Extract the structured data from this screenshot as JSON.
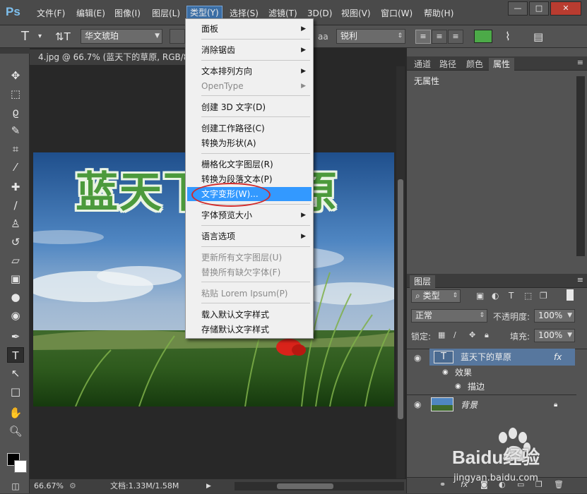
{
  "app": {
    "logo": "Ps"
  },
  "menubar": {
    "items": [
      "文件(F)",
      "编辑(E)",
      "图像(I)",
      "图层(L)",
      "类型(Y)",
      "选择(S)",
      "滤镜(T)",
      "3D(D)",
      "视图(V)",
      "窗口(W)",
      "帮助(H)"
    ],
    "active": "类型(Y)"
  },
  "window_controls": {
    "minimize": "—",
    "maximize": "□",
    "close": "✕"
  },
  "options": {
    "font_family": "华文琥珀",
    "antialias_label": "aa",
    "antialias": "锐利"
  },
  "document": {
    "tab_title": "4.jpg @ 66.7% (蓝天下的草原, RGB/8#",
    "canvas_text": "蓝天下的草原",
    "zoom": "66.67%",
    "file_size": "文档:1.33M/1.58M"
  },
  "panels_top": {
    "tabs": [
      "通道",
      "路径",
      "颜色",
      "属性"
    ],
    "active_tab": "属性",
    "content": "无属性"
  },
  "layers_panel": {
    "title": "图层",
    "filter_kind": "类型",
    "blend_mode": "正常",
    "opacity_label": "不透明度:",
    "opacity": "100%",
    "lock_label": "锁定:",
    "fill_label": "填充:",
    "fill": "100%",
    "layers": [
      {
        "name": "蓝天下的草原",
        "kind": "text",
        "fx": "fx",
        "effects_label": "效果",
        "effects": [
          "描边"
        ]
      },
      {
        "name": "背景",
        "kind": "image"
      }
    ]
  },
  "type_menu": {
    "items": [
      {
        "label": "面板",
        "submenu": true,
        "enabled": true
      },
      {
        "label": "消除锯齿",
        "submenu": true,
        "enabled": true
      },
      {
        "label": "文本排列方向",
        "submenu": true,
        "enabled": true
      },
      {
        "label": "OpenType",
        "submenu": true,
        "enabled": false
      },
      {
        "label": "创建 3D 文字(D)",
        "submenu": false,
        "enabled": true
      },
      {
        "label": "创建工作路径(C)",
        "submenu": false,
        "enabled": true
      },
      {
        "label": "转换为形状(A)",
        "submenu": false,
        "enabled": true
      },
      {
        "label": "栅格化文字图层(R)",
        "submenu": false,
        "enabled": true
      },
      {
        "label": "转换为段落文本(P)",
        "submenu": false,
        "enabled": true
      },
      {
        "label": "文字变形(W)...",
        "submenu": false,
        "enabled": true,
        "highlighted": true
      },
      {
        "label": "字体预览大小",
        "submenu": true,
        "enabled": true
      },
      {
        "label": "语言选项",
        "submenu": true,
        "enabled": true
      },
      {
        "label": "更新所有文字图层(U)",
        "submenu": false,
        "enabled": false
      },
      {
        "label": "替换所有缺欠字体(F)",
        "submenu": false,
        "enabled": false
      },
      {
        "label": "粘贴 Lorem Ipsum(P)",
        "submenu": false,
        "enabled": false
      },
      {
        "label": "载入默认文字样式",
        "submenu": false,
        "enabled": true
      },
      {
        "label": "存储默认文字样式",
        "submenu": false,
        "enabled": true
      }
    ]
  },
  "watermark": {
    "brand": "Baidu经验",
    "url": "jingyan.baidu.com"
  },
  "colors": {
    "accent": "#3399ff",
    "annotation": "#d12b2b",
    "text_fill": "#4c9a3c"
  }
}
